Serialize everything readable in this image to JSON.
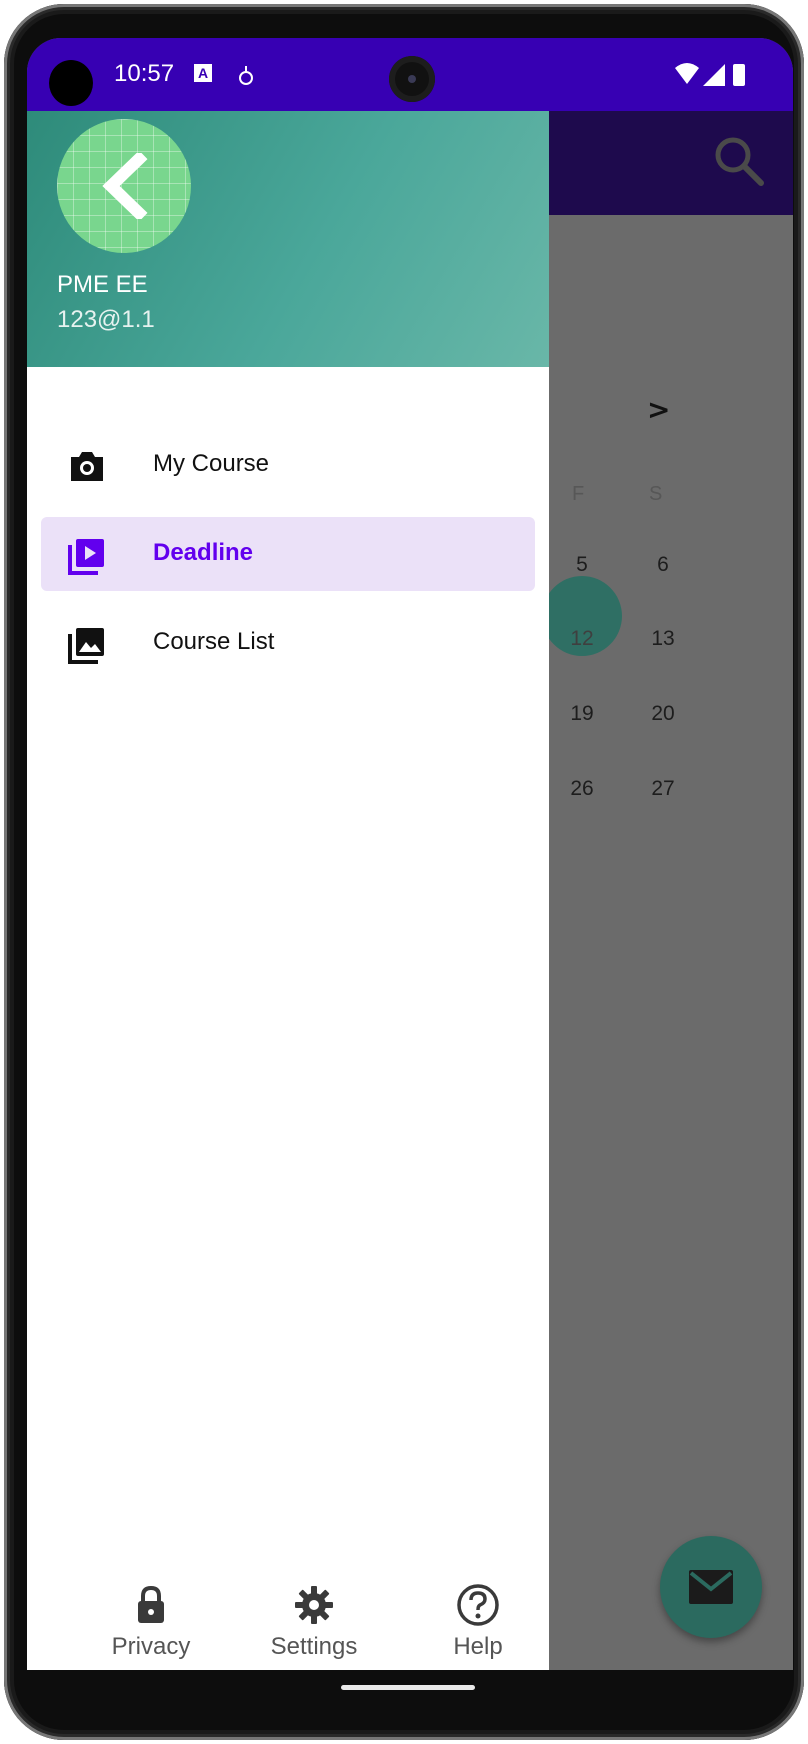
{
  "status_bar": {
    "time": "10:57",
    "notification_badge": "A",
    "icons": [
      "wifi-icon",
      "signal-icon",
      "battery-icon"
    ]
  },
  "drawer": {
    "user": {
      "name": "PME EE",
      "email": "123@1.1"
    },
    "items": [
      {
        "label": "My Course",
        "icon": "camera-icon",
        "active": false
      },
      {
        "label": "Deadline",
        "icon": "video-library-icon",
        "active": true
      },
      {
        "label": "Course List",
        "icon": "photo-library-icon",
        "active": false
      }
    ],
    "bottom_nav": [
      {
        "label": "Privacy",
        "icon": "lock-icon"
      },
      {
        "label": "Settings",
        "icon": "gear-icon"
      },
      {
        "label": "Help",
        "icon": "help-circle-icon"
      }
    ]
  },
  "calendar": {
    "headers": [
      "F",
      "S"
    ],
    "rows": [
      [
        "5",
        "6"
      ],
      [
        "12",
        "13"
      ],
      [
        "19",
        "20"
      ],
      [
        "26",
        "27"
      ]
    ],
    "today": "12"
  },
  "colors": {
    "status_bar": "#3700b3",
    "drawer_accent": "#6200ee",
    "active_bg": "#ebe1f8",
    "header_teal": "#4aa79a",
    "fab": "#2b6a5f"
  }
}
